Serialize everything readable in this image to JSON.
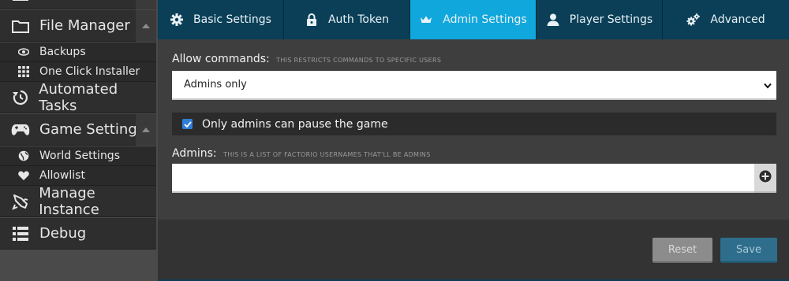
{
  "sidebar": {
    "items": [
      {
        "label": "",
        "icon": "window-icon"
      },
      {
        "label": "File Manager",
        "icon": "folder-icon"
      },
      {
        "label": "Backups",
        "icon": "eye-icon"
      },
      {
        "label": "One Click Installer",
        "icon": "grid-icon"
      },
      {
        "label": "Automated Tasks",
        "icon": "refresh-clock-icon"
      },
      {
        "label": "Game Settings",
        "icon": "gamepad-icon"
      },
      {
        "label": "World Settings",
        "icon": "globe-icon"
      },
      {
        "label": "Allowlist",
        "icon": "heart-icon"
      },
      {
        "label": "Manage Instance",
        "icon": "rocket-icon"
      },
      {
        "label": "Debug",
        "icon": "list-icon"
      }
    ]
  },
  "tabs": [
    {
      "label": "Basic Settings",
      "icon": "gear-icon",
      "active": false
    },
    {
      "label": "Auth Token",
      "icon": "lock-icon",
      "active": false
    },
    {
      "label": "Admin Settings",
      "icon": "crown-icon",
      "active": true
    },
    {
      "label": "Player Settings",
      "icon": "user-icon",
      "active": false
    },
    {
      "label": "Advanced",
      "icon": "gears-icon",
      "active": false
    }
  ],
  "form": {
    "allow_commands_label": "Allow commands:",
    "allow_commands_hint": "THIS RESTRICTS COMMANDS TO SPECIFIC USERS",
    "allow_commands_value": "Admins only",
    "pause_label": "Only admins can pause the game",
    "pause_checked": true,
    "admins_label": "Admins:",
    "admins_hint": "THIS IS A LIST OF FACTORIO USERNAMES THAT'LL BE ADMINS",
    "admins_value": ""
  },
  "footer": {
    "reset_label": "Reset",
    "save_label": "Save"
  },
  "colors": {
    "tab_bg": "#0a3f57",
    "tab_active": "#10a7dc",
    "sidebar_bg": "#2e2e2e",
    "checkbox": "#2f7fd8"
  }
}
